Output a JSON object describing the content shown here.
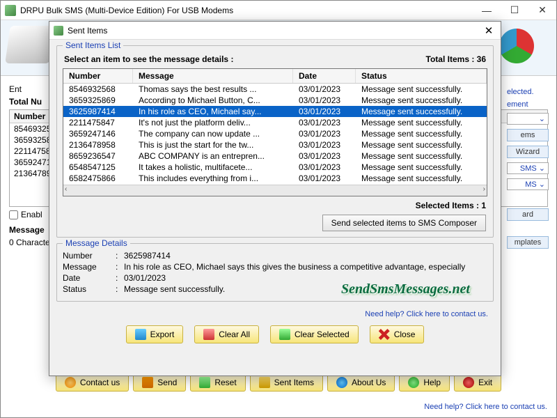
{
  "main": {
    "title": "DRPU Bulk SMS (Multi-Device Edition) For USB Modems",
    "enter_label": "Ent",
    "total_label": "Total Nu",
    "numbers_header": "Number",
    "numbers": [
      "8546932568",
      "3659325869",
      "2211475847",
      "3659247146",
      "2136478958"
    ],
    "enable_label": "Enabl",
    "message_label": "Message",
    "chars_label": "0 Characte"
  },
  "right": {
    "selected": "elected.",
    "management": "ement",
    "items": "ems",
    "wizard": "Wizard",
    "sms1": "SMS",
    "sms2": "MS",
    "ard": "ard",
    "templates": "mplates"
  },
  "toolbar": {
    "contact": "Contact us",
    "send": "Send",
    "reset": "Reset",
    "sent": "Sent Items",
    "about": "About Us",
    "help": "Help",
    "exit": "Exit"
  },
  "help_link": "Need help? Click here to contact us.",
  "dialog": {
    "title": "Sent Items",
    "group_title": "Sent Items List",
    "instruction": "Select an item to see the message details :",
    "total_label": "Total Items : 36",
    "columns": {
      "number": "Number",
      "message": "Message",
      "date": "Date",
      "status": "Status"
    },
    "rows": [
      {
        "number": "8546932568",
        "message": "Thomas says the best results ...",
        "date": "03/01/2023",
        "status": "Message sent successfully."
      },
      {
        "number": "3659325869",
        "message": "According to Michael Button, C...",
        "date": "03/01/2023",
        "status": "Message sent successfully."
      },
      {
        "number": "3625987414",
        "message": "In his role as CEO, Michael say...",
        "date": "03/01/2023",
        "status": "Message sent successfully.",
        "selected": true
      },
      {
        "number": "2211475847",
        "message": "It's not just the platform deliv...",
        "date": "03/01/2023",
        "status": "Message sent successfully."
      },
      {
        "number": "3659247146",
        "message": "The company can now update ...",
        "date": "03/01/2023",
        "status": "Message sent successfully."
      },
      {
        "number": "2136478958",
        "message": "This is just the start for the tw...",
        "date": "03/01/2023",
        "status": "Message sent successfully."
      },
      {
        "number": "8659236547",
        "message": "ABC COMPANY is an entrepren...",
        "date": "03/01/2023",
        "status": "Message sent successfully."
      },
      {
        "number": "6548547125",
        "message": "It takes a holistic, multifacete...",
        "date": "03/01/2023",
        "status": "Message sent successfully."
      },
      {
        "number": "6582475866",
        "message": "This includes everything from i...",
        "date": "03/01/2023",
        "status": "Message sent successfully."
      }
    ],
    "selected_label": "Selected Items : 1",
    "send_composer": "Send selected items to SMS Composer",
    "details_title": "Message Details",
    "details": {
      "number_label": "Number",
      "number": "3625987414",
      "message_label": "Message",
      "message": "In his role as CEO, Michael says this gives the business a competitive advantage, especially",
      "date_label": "Date",
      "date": "03/01/2023",
      "status_label": "Status",
      "status": "Message sent successfully."
    },
    "buttons": {
      "export": "Export",
      "clear_all": "Clear All",
      "clear_selected": "Clear Selected",
      "close": "Close"
    }
  },
  "watermark": "SendSmsMessages.net"
}
